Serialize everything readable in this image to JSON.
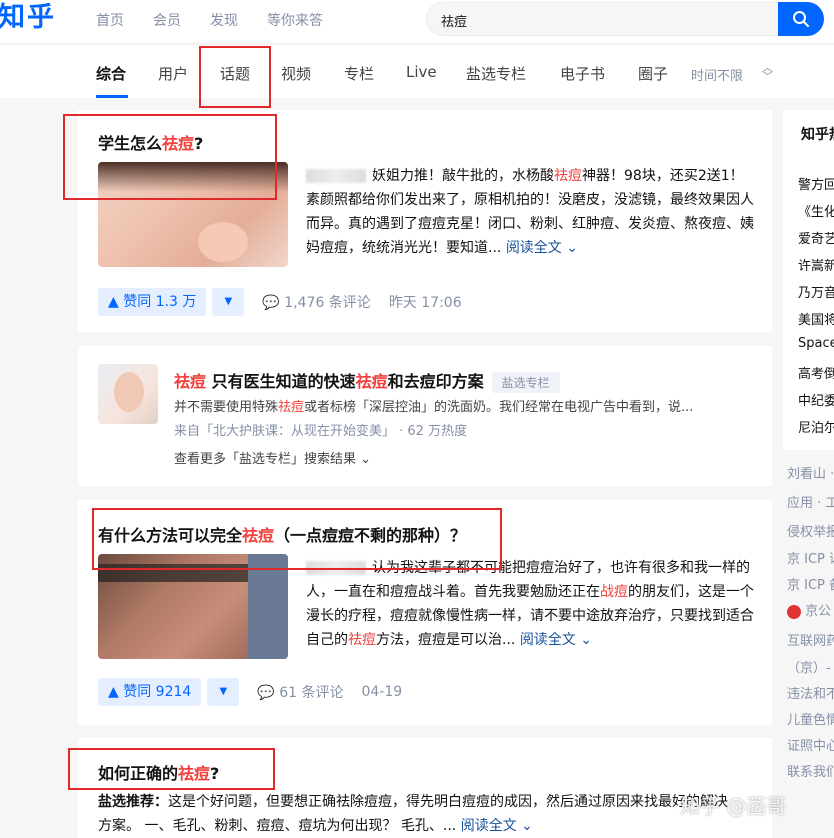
{
  "header": {
    "logo": "知乎",
    "nav": [
      "首页",
      "会员",
      "发现",
      "等你来答"
    ],
    "search_query": "祛痘"
  },
  "tabs": {
    "items": [
      "综合",
      "用户",
      "话题",
      "视频",
      "专栏",
      "Live",
      "盐选专栏",
      "电子书",
      "圈子"
    ],
    "active": "综合",
    "time_filter": "时间不限"
  },
  "results": [
    {
      "title_pre": "学生怎么",
      "title_hl": "祛痘",
      "title_post": "?",
      "excerpt_a": "妖姐力推！敲牛批的，水杨酸",
      "excerpt_hl": "祛痘",
      "excerpt_b": "神器！98块，还买2送1！素颜照都给你们发出来了，原相机拍的！没磨皮，没滤镜，最终效果因人而异。真的遇到了痘痘克星！闭口、粉刺、红肿痘、发炎痘、熬夜痘、姨妈痘痘，统统消光光！要知道...",
      "read_more": "阅读全文",
      "vote": "赞同 1.3 万",
      "comments": "1,476 条评论",
      "time": "昨天 17:06"
    },
    {
      "title_hl1": "祛痘",
      "title_mid": " 只有医生知道的快速",
      "title_hl2": "祛痘",
      "title_post": "和去痘印方案",
      "badge": "盐选专栏",
      "desc_a": "并不需要使用特殊",
      "desc_hl": "祛痘",
      "desc_b": "或者标榜「深层控油」的洗面奶。我们经常在电视广告中看到，说...",
      "source": "来自「北大护肤课：从现在开始变美」 · 62 万热度",
      "more": "查看更多「盐选专栏」搜索结果"
    },
    {
      "title_pre": "有什么方法可以完全",
      "title_hl": "祛痘",
      "title_post": "（一点痘痘不剩的那种）？",
      "excerpt_a": "认为我这辈子都不可能把痘痘治好了，也许有很多和我一样的人，一直在和痘痘战斗着。首先我要勉励还正在",
      "excerpt_hl": "战痘",
      "excerpt_b": "的朋友们，这是一个漫长的疗程，痘痘就像慢性病一样，请不要中途放弃治疗，只要找到适合自己的",
      "excerpt_hl2": "祛痘",
      "excerpt_c": "方法，痘痘是可以治...",
      "read_more": "阅读全文",
      "vote": "赞同 9214",
      "comments": "61 条评论",
      "time": "04-19"
    },
    {
      "title_pre": "如何正确的",
      "title_hl": "祛痘",
      "title_post": "?",
      "excerpt_label": "盐选推荐：",
      "excerpt": "这是个好问题，但要想正确祛除痘痘，得先明白痘痘的成因，然后通过原因来找最好的解决方案。 一、毛孔、粉刺、痘痘、痘坑为何出现？ 毛孔、...",
      "read_more": "阅读全文"
    }
  ],
  "sidebar": {
    "title": "知乎热",
    "items": [
      "警方回",
      "《生化",
      "爱奇艺",
      "许嵩新",
      "乃万音",
      "美国将",
      "Space",
      "高考倒",
      "中纪委",
      "尼泊尔"
    ],
    "footer": [
      "刘看山 ·",
      "应用 · 工",
      "侵权举报",
      "京 ICP 证",
      "京 ICP 备",
      "京公",
      "互联网药",
      "（京）-",
      "违法和不",
      "儿童色情",
      "证照中心",
      "联系我们"
    ]
  },
  "watermark": "知乎 @菡哥"
}
